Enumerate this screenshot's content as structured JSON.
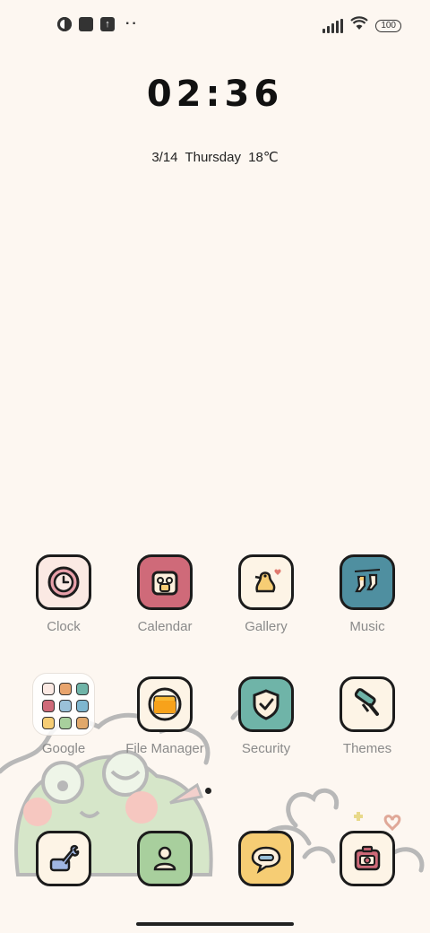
{
  "status_bar": {
    "left_icons": [
      "app-notification-icon",
      "square-notification-icon",
      "upload-icon",
      "more-notifications-icon"
    ],
    "battery": "100"
  },
  "widget": {
    "time": "02:36",
    "date": "3/14",
    "weekday": "Thursday",
    "temperature": "18℃"
  },
  "apps": {
    "clock": {
      "label": "Clock",
      "color": "#fbe9e3"
    },
    "calendar": {
      "label": "Calendar",
      "color": "#cf6a79"
    },
    "gallery": {
      "label": "Gallery",
      "color": "#fdf4e6"
    },
    "music": {
      "label": "Music",
      "color": "#4f8fa0"
    },
    "google": {
      "label": "Google"
    },
    "file_manager": {
      "label": "File Manager",
      "color": "#fdf4e6"
    },
    "security": {
      "label": "Security",
      "color": "#6fb4a8"
    },
    "themes": {
      "label": "Themes",
      "color": "#fdf4e6"
    }
  },
  "dock": {
    "tools": {
      "color": "#fdf4e6"
    },
    "contacts": {
      "color": "#a8cf9d"
    },
    "messages": {
      "color": "#f6cd74"
    },
    "camera": {
      "color": "#fdf4e6"
    }
  }
}
